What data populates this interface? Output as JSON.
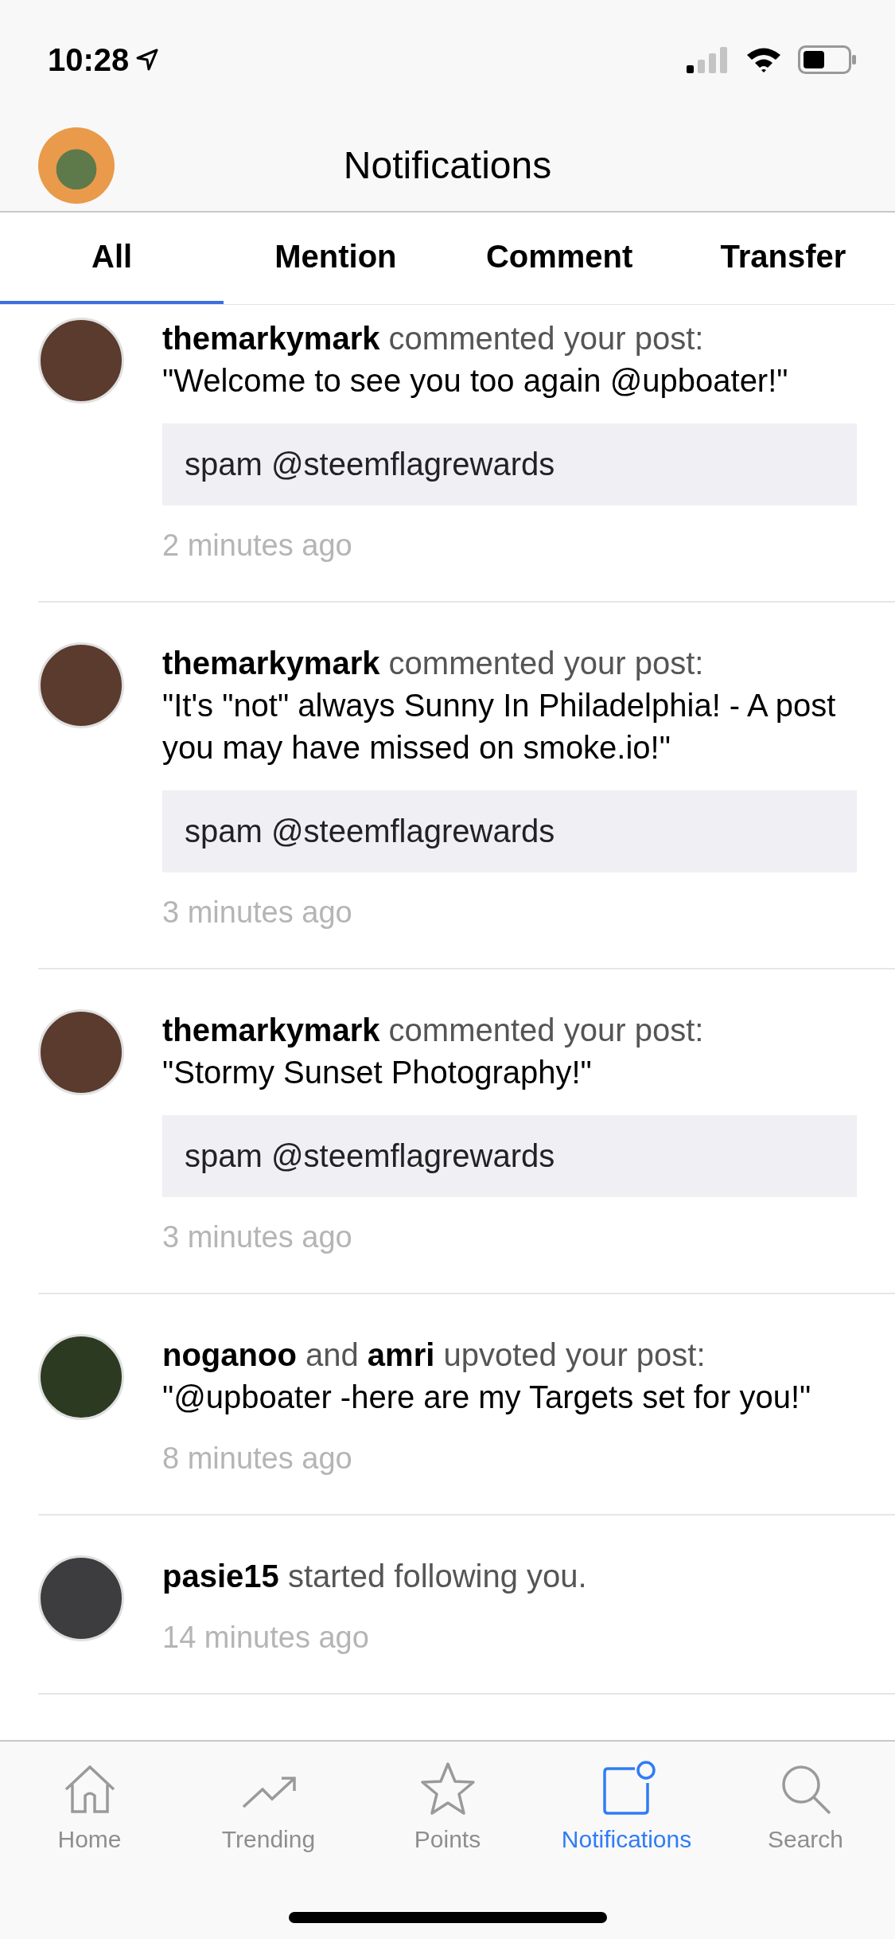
{
  "status_bar": {
    "time": "10:28"
  },
  "header": {
    "title": "Notifications"
  },
  "tabs": [
    {
      "label": "All",
      "selected": true
    },
    {
      "label": "Mention",
      "selected": false
    },
    {
      "label": "Comment",
      "selected": false
    },
    {
      "label": "Transfer",
      "selected": false
    }
  ],
  "notifications": [
    {
      "header": "**themarkymark** commented your post:",
      "body": "\"Welcome to see you too again @upboater!\"",
      "comment": "spam @steemflagrewards",
      "time": "2 minutes ago",
      "color": "#5a3b2e"
    },
    {
      "header": "**themarkymark** commented your post:",
      "body": "\"It's \"not\" always Sunny In Philadelphia! - A post you may have missed on smoke.io!\"",
      "comment": "spam @steemflagrewards",
      "time": "3 minutes ago",
      "color": "#5a3b2e"
    },
    {
      "header": "**themarkymark** commented your post:",
      "body": "\"Stormy Sunset Photography!\"",
      "comment": "spam @steemflagrewards",
      "time": "3 minutes ago",
      "color": "#5a3b2e"
    },
    {
      "header": "**noganoo** and **amri** upvoted your post:",
      "body": "\"@upboater -here are my Targets set for you!\"",
      "time": "8 minutes ago",
      "color": "#2c3a22"
    },
    {
      "header": "**pasie15** started following you.",
      "time": "14 minutes ago",
      "color": "#3d3d3f"
    }
  ],
  "tab_bar": [
    {
      "label": "Home",
      "kind": "home",
      "selected": false
    },
    {
      "label": "Trending",
      "kind": "trending",
      "selected": false
    },
    {
      "label": "Points",
      "kind": "points",
      "selected": false
    },
    {
      "label": "Notifications",
      "kind": "notifications",
      "selected": true
    },
    {
      "label": "Search",
      "kind": "search",
      "selected": false
    }
  ]
}
